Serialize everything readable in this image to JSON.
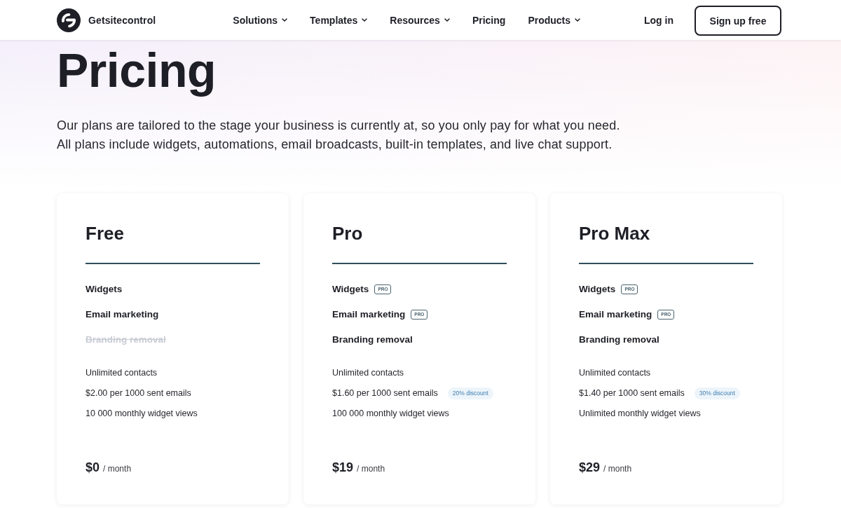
{
  "header": {
    "brand": "Getsitecontrol",
    "nav": [
      {
        "label": "Solutions",
        "dropdown": true
      },
      {
        "label": "Templates",
        "dropdown": true
      },
      {
        "label": "Resources",
        "dropdown": true
      },
      {
        "label": "Pricing",
        "dropdown": false
      },
      {
        "label": "Products",
        "dropdown": true
      }
    ],
    "login": "Log in",
    "signup": "Sign up free"
  },
  "hero": {
    "title": "Pricing",
    "lines": [
      "Our plans are tailored to the stage your business is currently at, so you only pay for what you need.",
      "All plans include widgets, automations, email broadcasts, built-in templates, and live chat support."
    ]
  },
  "plans": [
    {
      "name": "Free",
      "features": [
        {
          "label": "Widgets",
          "included": true
        },
        {
          "label": "Email marketing",
          "included": true
        },
        {
          "label": "Branding removal",
          "included": false
        }
      ],
      "stats": [
        {
          "text": "Unlimited contacts"
        },
        {
          "text": "$2.00 per 1000 sent emails"
        },
        {
          "text": "10 000 monthly widget views"
        }
      ],
      "price": "$0",
      "period": "/ month"
    },
    {
      "name": "Pro",
      "features": [
        {
          "label": "Widgets",
          "included": true,
          "badge": "PRO"
        },
        {
          "label": "Email marketing",
          "included": true,
          "badge": "PRO"
        },
        {
          "label": "Branding removal",
          "included": true
        }
      ],
      "stats": [
        {
          "text": "Unlimited contacts"
        },
        {
          "text": "$1.60 per 1000 sent emails",
          "discount": "20% discount"
        },
        {
          "text": "100 000 monthly widget views"
        }
      ],
      "price": "$19",
      "period": "/ month"
    },
    {
      "name": "Pro Max",
      "features": [
        {
          "label": "Widgets",
          "included": true,
          "badge": "PRO"
        },
        {
          "label": "Email marketing",
          "included": true,
          "badge": "PRO"
        },
        {
          "label": "Branding removal",
          "included": true
        }
      ],
      "stats": [
        {
          "text": "Unlimited contacts"
        },
        {
          "text": "$1.40 per 1000 sent emails",
          "discount": "30% discount"
        },
        {
          "text": "Unlimited monthly widget views"
        }
      ],
      "price": "$29",
      "period": "/ month"
    }
  ]
}
